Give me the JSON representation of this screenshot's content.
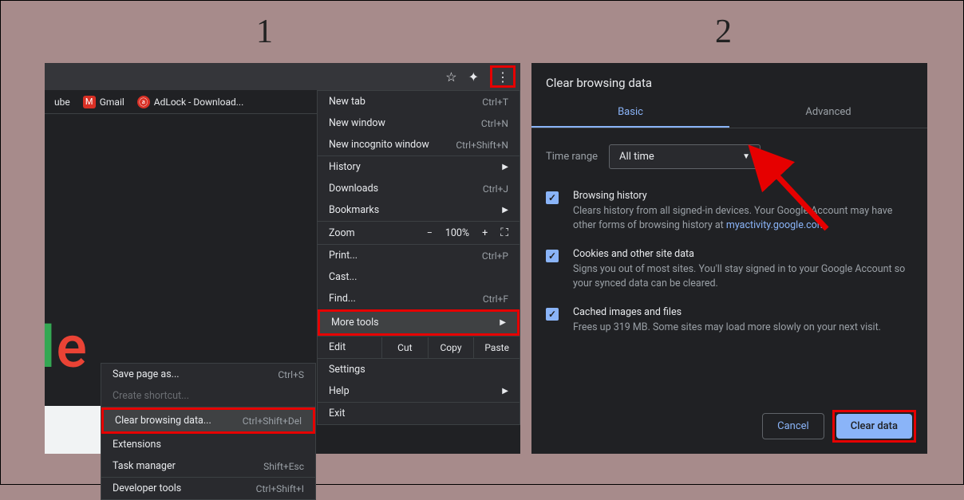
{
  "steps": {
    "one": "1",
    "two": "2"
  },
  "bookmarks": {
    "ube": "ube",
    "gmail": "Gmail",
    "adlock": "AdLock - Download..."
  },
  "menu": {
    "new_tab": "New tab",
    "new_tab_sc": "Ctrl+T",
    "new_window": "New window",
    "new_window_sc": "Ctrl+N",
    "new_incognito": "New incognito window",
    "new_incognito_sc": "Ctrl+Shift+N",
    "history": "History",
    "downloads": "Downloads",
    "downloads_sc": "Ctrl+J",
    "bookmarks": "Bookmarks",
    "zoom": "Zoom",
    "zoom_val": "100%",
    "print": "Print...",
    "print_sc": "Ctrl+P",
    "cast": "Cast...",
    "find": "Find...",
    "find_sc": "Ctrl+F",
    "more_tools": "More tools",
    "edit": "Edit",
    "cut": "Cut",
    "copy": "Copy",
    "paste": "Paste",
    "settings": "Settings",
    "help": "Help",
    "exit": "Exit"
  },
  "submenu": {
    "save_page": "Save page as...",
    "save_page_sc": "Ctrl+S",
    "create_shortcut": "Create shortcut...",
    "clear_browsing": "Clear browsing data...",
    "clear_browsing_sc": "Ctrl+Shift+Del",
    "extensions": "Extensions",
    "task_manager": "Task manager",
    "task_manager_sc": "Shift+Esc",
    "developer_tools": "Developer tools",
    "developer_tools_sc": "Ctrl+Shift+I"
  },
  "dialog": {
    "title": "Clear browsing data",
    "tab_basic": "Basic",
    "tab_advanced": "Advanced",
    "time_range_label": "Time range",
    "time_range_value": "All time",
    "opt1_title": "Browsing history",
    "opt1_desc1": "Clears history from all signed-in devices. Your Google Account may have other forms of browsing history at ",
    "opt1_link": "myactivity.google.com",
    "opt1_desc2": ".",
    "opt2_title": "Cookies and other site data",
    "opt2_desc": "Signs you out of most sites. You'll stay signed in to your Google Account so your synced data can be cleared.",
    "opt3_title": "Cached images and files",
    "opt3_desc": "Frees up 319 MB. Some sites may load more slowly on your next visit.",
    "cancel": "Cancel",
    "clear": "Clear data"
  }
}
